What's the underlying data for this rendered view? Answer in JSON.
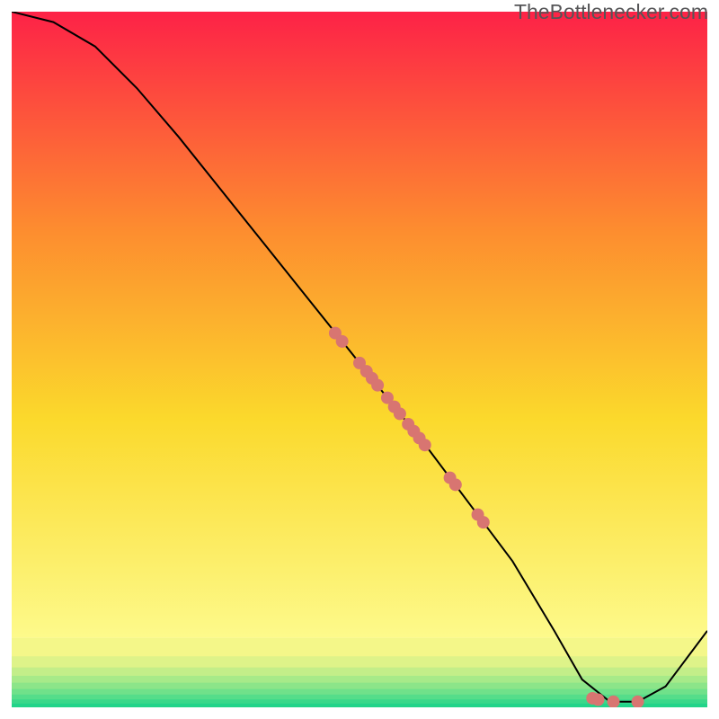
{
  "attribution": "TheBottlenecker.com",
  "chart_data": {
    "type": "line",
    "xlim": [
      0,
      100
    ],
    "ylim": [
      0,
      100
    ],
    "title": "",
    "xlabel": "",
    "ylabel": "",
    "series": [
      {
        "name": "bottleneck-curve",
        "x": [
          0,
          6,
          12,
          18,
          24,
          30,
          36,
          42,
          48,
          54,
          60,
          66,
          72,
          78,
          82,
          86,
          90,
          94,
          100
        ],
        "y": [
          100,
          98.5,
          95,
          89,
          82,
          74.5,
          67,
          59.5,
          52,
          44.5,
          37,
          29,
          21,
          11,
          4,
          0.8,
          0.8,
          3,
          11
        ]
      }
    ],
    "points": [
      {
        "name": "cluster-upper-1",
        "x": 46.5,
        "y": 53.8
      },
      {
        "name": "cluster-upper-2",
        "x": 47.5,
        "y": 52.6
      },
      {
        "name": "cluster-main-1",
        "x": 50.0,
        "y": 49.5
      },
      {
        "name": "cluster-main-2",
        "x": 51.0,
        "y": 48.3
      },
      {
        "name": "cluster-main-3",
        "x": 51.8,
        "y": 47.3
      },
      {
        "name": "cluster-main-4",
        "x": 52.6,
        "y": 46.3
      },
      {
        "name": "cluster-main-5",
        "x": 54.0,
        "y": 44.5
      },
      {
        "name": "cluster-main-6",
        "x": 55.0,
        "y": 43.2
      },
      {
        "name": "cluster-main-7",
        "x": 55.8,
        "y": 42.2
      },
      {
        "name": "cluster-main-8",
        "x": 57.0,
        "y": 40.7
      },
      {
        "name": "cluster-main-9",
        "x": 57.8,
        "y": 39.7
      },
      {
        "name": "cluster-main-10",
        "x": 58.6,
        "y": 38.7
      },
      {
        "name": "cluster-main-11",
        "x": 59.4,
        "y": 37.7
      },
      {
        "name": "cluster-mid-1",
        "x": 63.0,
        "y": 33.0
      },
      {
        "name": "cluster-mid-2",
        "x": 63.8,
        "y": 32.0
      },
      {
        "name": "cluster-low-1",
        "x": 67.0,
        "y": 27.7
      },
      {
        "name": "cluster-low-2",
        "x": 67.8,
        "y": 26.6
      },
      {
        "name": "bottom-1",
        "x": 83.5,
        "y": 1.3
      },
      {
        "name": "bottom-2",
        "x": 84.3,
        "y": 1.1
      },
      {
        "name": "bottom-3",
        "x": 86.5,
        "y": 0.8
      },
      {
        "name": "bottom-4",
        "x": 90.0,
        "y": 0.8
      }
    ],
    "bands": [
      {
        "name": "green-6",
        "y0": 0.0,
        "y1": 0.6,
        "color": "#22d48a"
      },
      {
        "name": "green-5",
        "y0": 0.6,
        "y1": 1.2,
        "color": "#3ad88a"
      },
      {
        "name": "green-4",
        "y0": 1.2,
        "y1": 1.9,
        "color": "#55dd8a"
      },
      {
        "name": "green-3",
        "y0": 1.9,
        "y1": 2.7,
        "color": "#70e18a"
      },
      {
        "name": "green-2",
        "y0": 2.7,
        "y1": 3.6,
        "color": "#8ce589"
      },
      {
        "name": "green-1",
        "y0": 3.6,
        "y1": 4.6,
        "color": "#a7ea89"
      },
      {
        "name": "green-0",
        "y0": 4.6,
        "y1": 5.8,
        "color": "#c3ee89"
      },
      {
        "name": "yg-2",
        "y0": 5.8,
        "y1": 7.4,
        "color": "#def389"
      },
      {
        "name": "yg-1",
        "y0": 7.4,
        "y1": 10.0,
        "color": "#f4f789"
      }
    ],
    "colors": {
      "gradient_top": "#fd2247",
      "gradient_bottom": "#fdfa8b",
      "point_fill": "#d87571",
      "curve_stroke": "#000000",
      "frame_stroke": "#ffffff"
    }
  }
}
